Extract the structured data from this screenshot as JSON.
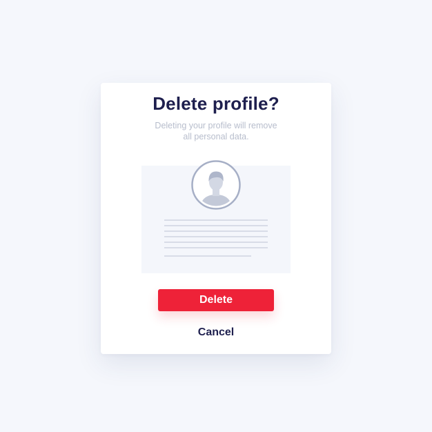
{
  "dialog": {
    "title": "Delete profile?",
    "description_lines": [
      "Deleting your profile will remove",
      "all personal data."
    ],
    "delete_label": "Delete",
    "cancel_label": "Cancel"
  },
  "colors": {
    "background": "#f5f7fc",
    "title": "#1e1f4e",
    "description": "#b7bdcc",
    "danger": "#ee2238",
    "avatar_stroke": "#a6afc6",
    "avatar_fill": "#c3c9d8",
    "placeholder_lines": "#d8dce7"
  },
  "icons": {
    "avatar": "user-avatar-icon"
  }
}
